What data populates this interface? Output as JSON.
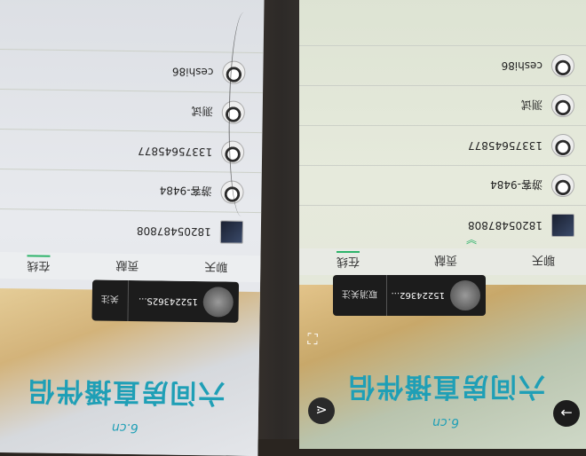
{
  "brand": {
    "name": "六间房直播伴侣",
    "sub": "6.cn"
  },
  "tabs": [
    "聊天",
    "贡献",
    "在线"
  ],
  "left": {
    "follow_card": {
      "name": "15224362S...",
      "button": "关注"
    },
    "users": [
      "18205487808",
      "游客-9484",
      "13375645877",
      "测试",
      "ceshi86"
    ]
  },
  "right": {
    "follow_card": {
      "name": "15224362...",
      "button": "取消关注"
    },
    "users": [
      "18205487808",
      "游客-9484",
      "13375645877",
      "测试",
      "ceshi86"
    ]
  },
  "colors": {
    "accent": "#2db36a",
    "brand": "#1f9fb6"
  }
}
